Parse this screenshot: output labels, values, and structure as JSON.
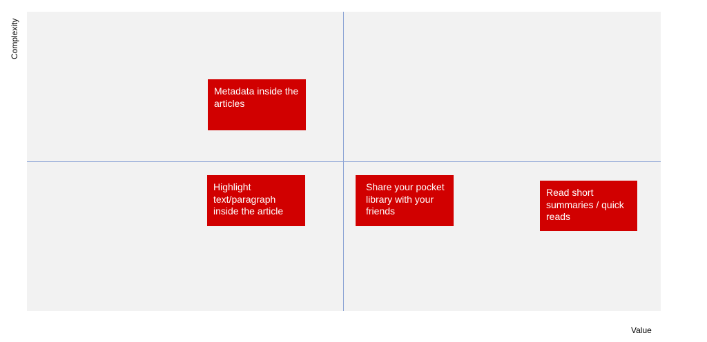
{
  "axes": {
    "y_label": "Complexity",
    "x_label": "Value"
  },
  "cards": [
    {
      "text": "Metadata inside the articles"
    },
    {
      "text": "Highlight text/paragraph inside the article"
    },
    {
      "text": "Share your pocket library with your friends"
    },
    {
      "text": "Read short summaries / quick reads"
    }
  ],
  "colors": {
    "card_fill": "#d10000",
    "background": "#f2f2f2",
    "axis_line": "#8ea6d6"
  }
}
